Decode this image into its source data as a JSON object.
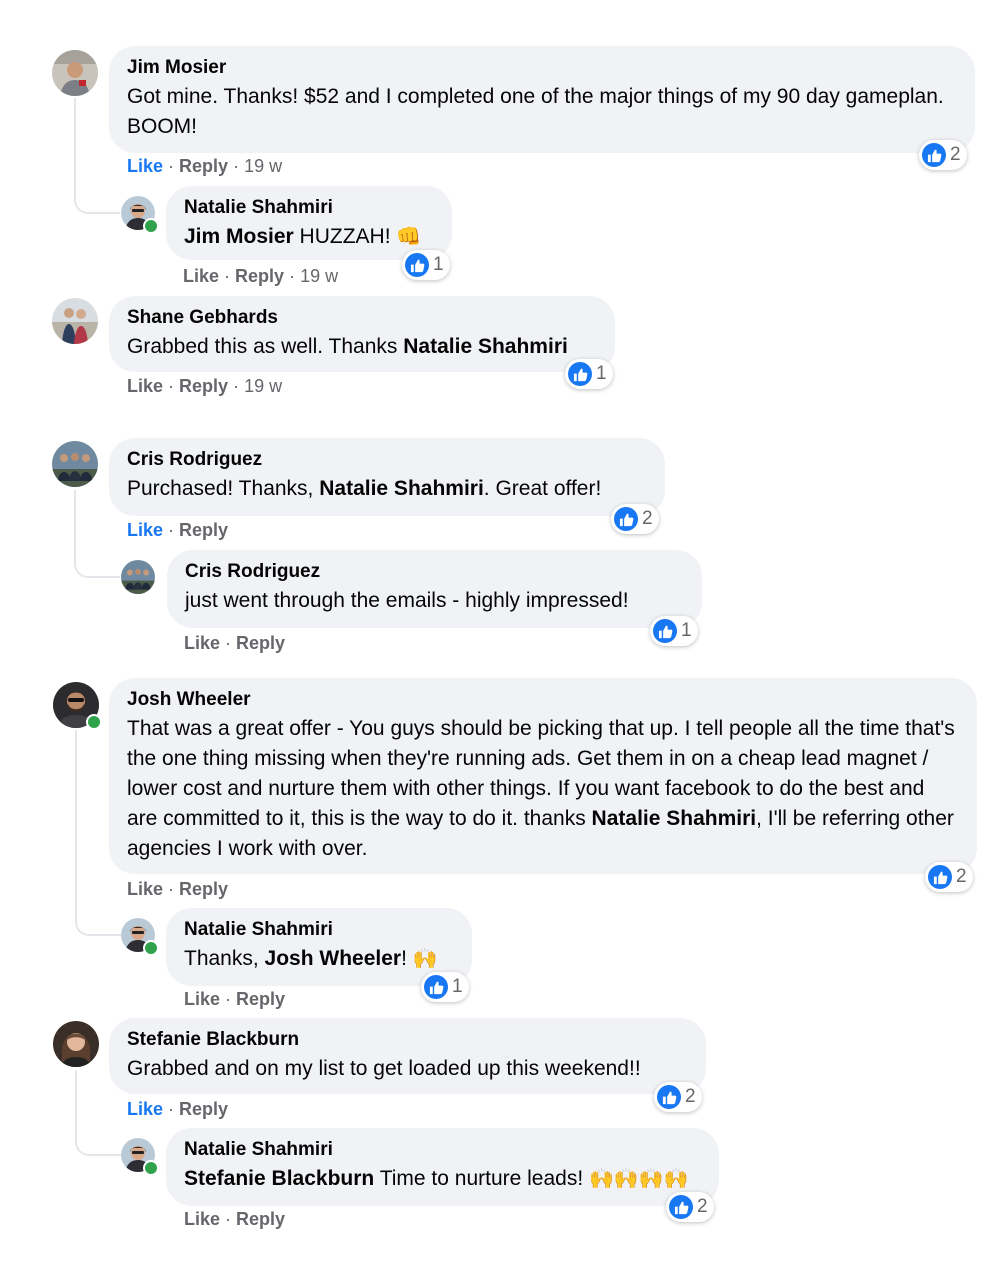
{
  "common": {
    "like": "Like",
    "reply": "Reply",
    "dot": "·"
  },
  "emoji": {
    "fist": "👊",
    "raised_hands": "🙌"
  },
  "comments": [
    {
      "name": "Jim Mosier",
      "text": "Got mine. Thanks! $52 and I completed one of the major things of my 90 day gameplan. BOOM!",
      "time": "19 w",
      "reactions": "2",
      "avatar": "avatar-jim"
    },
    {
      "name": "Natalie Shahmiri",
      "mention": "Jim Mosier",
      "text": " HUZZAH! ",
      "time": "19 w",
      "reactions": "1",
      "avatar": "avatar-natalie",
      "online": true
    },
    {
      "name": "Shane Gebhards",
      "text": "Grabbed this as well. Thanks ",
      "mention": "Natalie Shahmiri",
      "time": "19 w",
      "reactions": "1",
      "avatar": "avatar-shane"
    },
    {
      "name": "Cris Rodriguez",
      "text_a": "Purchased! Thanks, ",
      "mention": "Natalie Shahmiri",
      "text_b": ". Great offer!",
      "reactions": "2",
      "avatar": "avatar-cris"
    },
    {
      "name": "Cris Rodriguez",
      "text": "just went through the emails - highly impressed!",
      "reactions": "1",
      "avatar": "avatar-cris"
    },
    {
      "name": "Josh Wheeler",
      "text_a": "That was a great offer - You guys should be picking that up. I tell people all the time that's the one thing missing when they're running ads. Get them in on a cheap lead magnet / lower cost and nurture them with other things. If you want facebook to do the best and are committed to it, this is the way to do it. thanks ",
      "mention": "Natalie Shahmiri",
      "text_b": ", I'll be referring other agencies I work with over.",
      "reactions": "2",
      "avatar": "avatar-josh",
      "online": true
    },
    {
      "name": "Natalie Shahmiri",
      "text_a": "Thanks, ",
      "mention": "Josh Wheeler",
      "text_b": "! ",
      "reactions": "1",
      "avatar": "avatar-natalie",
      "online": true
    },
    {
      "name": "Stefanie Blackburn",
      "text": "Grabbed and on my list to get loaded up this weekend!!",
      "reactions": "2",
      "avatar": "avatar-stefanie"
    },
    {
      "name": "Natalie Shahmiri",
      "mention": "Stefanie Blackburn",
      "text": " Time to nurture leads! ",
      "reactions": "2",
      "avatar": "avatar-natalie",
      "online": true
    }
  ]
}
